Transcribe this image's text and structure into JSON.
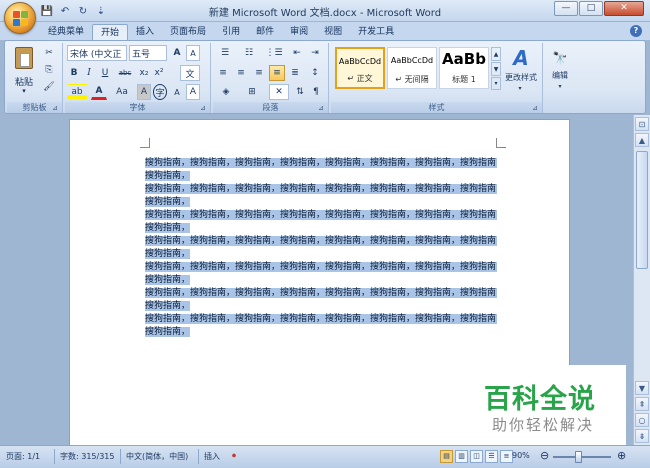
{
  "window": {
    "title": "新建 Microsoft Word 文档.docx - Microsoft Word",
    "min_label": "—",
    "max_label": "□",
    "close_label": "✕"
  },
  "qat": {
    "save_icon": "💾",
    "undo_icon": "↶",
    "redo_icon": "↻",
    "customize_icon": "⇣"
  },
  "tabs": [
    "经典菜单",
    "开始",
    "插入",
    "页面布局",
    "引用",
    "邮件",
    "审阅",
    "视图",
    "开发工具"
  ],
  "active_tab": "开始",
  "help": "?",
  "ribbon": {
    "clipboard": {
      "label": "剪贴板",
      "paste_label": "粘贴",
      "paste_arrow": "▾",
      "cut_icon": "✂",
      "copy_icon": "⎘",
      "format_painter_icon": "🖌"
    },
    "font": {
      "label": "字体",
      "font_name": "宋体 (中文正",
      "font_size": "五号",
      "grow": "A",
      "shrink": "A",
      "clear": "A",
      "bold": "B",
      "italic": "I",
      "underline": "U",
      "strike": "abc",
      "subscript": "x₂",
      "superscript": "x²",
      "case": "Aa",
      "highlight": "ab",
      "font_color": "A",
      "char_shading": "A",
      "enclose": "字",
      "pinyin": "文",
      "border": "A"
    },
    "paragraph": {
      "label": "段落",
      "bullets": "☰",
      "numbering": "☷",
      "multilevel": "⋮☰",
      "decrease_indent": "⇤",
      "increase_indent": "⇥",
      "align_left": "≡",
      "center": "≡",
      "align_right": "≡",
      "justify": "≡",
      "distribute": "≣",
      "line_spacing": "↕",
      "shading": "◈",
      "borders": "⊞",
      "chinese_layout": "✕",
      "sort": "⇅",
      "show_marks": "¶"
    },
    "styles": {
      "label": "样式",
      "items": [
        {
          "sample": "AaBbCcDd",
          "name": "↵ 正文"
        },
        {
          "sample": "AaBbCcDd",
          "name": "↵ 无间隔"
        },
        {
          "sample": "AaBb",
          "name": "标题 1"
        }
      ],
      "change_styles_label": "更改样式",
      "change_styles_icon": "A"
    },
    "editing": {
      "label": "编辑",
      "icon": "🔭"
    }
  },
  "document": {
    "lines": [
      "搜狗指南，搜狗指南，搜狗指南，搜狗指南，搜狗指南，搜狗指南，搜狗指南，搜狗指南，",
      "搜狗指南，",
      "搜狗指南，搜狗指南，搜狗指南，搜狗指南，搜狗指南，搜狗指南，搜狗指南，搜狗指南，",
      "搜狗指南，",
      "搜狗指南，搜狗指南，搜狗指南，搜狗指南，搜狗指南，搜狗指南，搜狗指南，搜狗指南，",
      "搜狗指南，",
      "搜狗指南，搜狗指南，搜狗指南，搜狗指南，搜狗指南，搜狗指南，搜狗指南，搜狗指南，",
      "搜狗指南，",
      "搜狗指南，搜狗指南，搜狗指南，搜狗指南，搜狗指南，搜狗指南，搜狗指南，搜狗指南，",
      "搜狗指南，",
      "搜狗指南，搜狗指南，搜狗指南，搜狗指南，搜狗指南，搜狗指南，搜狗指南，搜狗指南，",
      "搜狗指南，",
      "搜狗指南，搜狗指南，搜狗指南，搜狗指南，搜狗指南，搜狗指南，搜狗指南，搜狗指南，",
      "搜狗指南，"
    ]
  },
  "scrollbar": {
    "up": "▲",
    "down": "▼",
    "ruler": "⊡",
    "prev_page": "⇞",
    "browse": "○",
    "next_page": "⇟"
  },
  "watermark": {
    "title": "百科全说",
    "subtitle": "助你轻松解决"
  },
  "status": {
    "page": "页面: 1/1",
    "words": "字数: 315/315",
    "language": "中文(简体，中国)",
    "mode": "插入",
    "macro_icon": "⏺",
    "zoom": "90%",
    "zoom_out": "⊖",
    "zoom_in": "⊕",
    "zoom_level": 0.45
  }
}
